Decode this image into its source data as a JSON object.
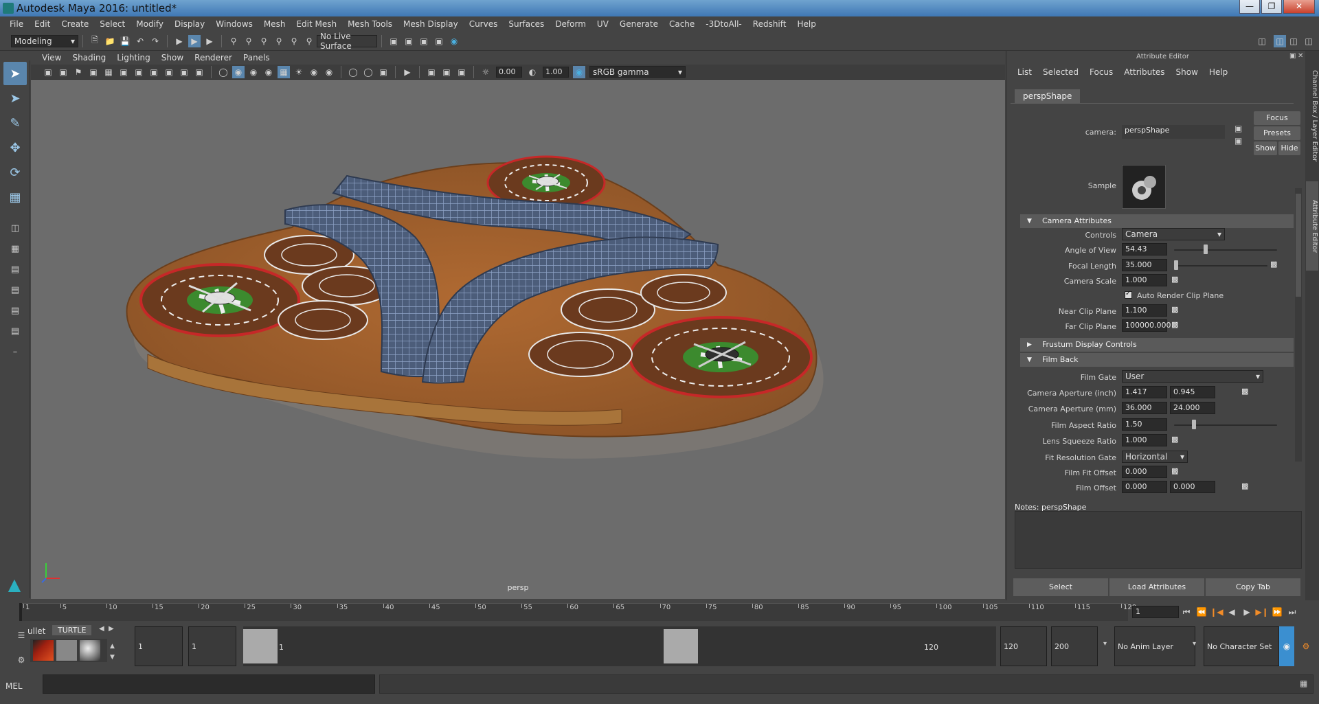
{
  "window": {
    "title": "Autodesk Maya 2016: untitled*"
  },
  "menubar": [
    "File",
    "Edit",
    "Create",
    "Select",
    "Modify",
    "Display",
    "Windows",
    "Mesh",
    "Edit Mesh",
    "Mesh Tools",
    "Mesh Display",
    "Curves",
    "Surfaces",
    "Deform",
    "UV",
    "Generate",
    "Cache",
    "-3DtoAll-",
    "Redshift",
    "Help"
  ],
  "shelf": {
    "menuset": "Modeling",
    "live_surface": "No Live Surface"
  },
  "viewport": {
    "menu": [
      "View",
      "Shading",
      "Lighting",
      "Show",
      "Renderer",
      "Panels"
    ],
    "exposure": "0.00",
    "gamma": "1.00",
    "color_space": "sRGB gamma",
    "camera_label": "persp"
  },
  "attribute_editor": {
    "title": "Attribute Editor",
    "menu": [
      "List",
      "Selected",
      "Focus",
      "Attributes",
      "Show",
      "Help"
    ],
    "tab": "perspShape",
    "camera_label": "camera:",
    "camera_value": "perspShape",
    "focus_btn": "Focus",
    "presets_btn": "Presets",
    "show_btn": "Show",
    "hide_btn": "Hide",
    "sample_label": "Sample",
    "sections": {
      "camera": "Camera Attributes",
      "frustum": "Frustum Display Controls",
      "filmback": "Film Back"
    },
    "controls": {
      "label": "Controls",
      "value": "Camera"
    },
    "angle_of_view": {
      "label": "Angle of View",
      "value": "54.43",
      "level": 0.3
    },
    "focal_length": {
      "label": "Focal Length",
      "value": "35.000",
      "level": 0.0
    },
    "camera_scale": {
      "label": "Camera Scale",
      "value": "1.000"
    },
    "auto_render_clip": {
      "label": "Auto Render Clip Plane",
      "checked": true
    },
    "near_clip": {
      "label": "Near Clip Plane",
      "value": "1.100"
    },
    "far_clip": {
      "label": "Far Clip Plane",
      "value": "100000.000"
    },
    "film_gate": {
      "label": "Film Gate",
      "value": "User"
    },
    "aperture_inch": {
      "label": "Camera Aperture (inch)",
      "v1": "1.417",
      "v2": "0.945"
    },
    "aperture_mm": {
      "label": "Camera Aperture (mm)",
      "v1": "36.000",
      "v2": "24.000"
    },
    "film_aspect": {
      "label": "Film Aspect Ratio",
      "value": "1.50",
      "level": 0.18
    },
    "lens_squeeze": {
      "label": "Lens Squeeze Ratio",
      "value": "1.000"
    },
    "fit_resolution": {
      "label": "Fit Resolution Gate",
      "value": "Horizontal"
    },
    "film_fit_offset": {
      "label": "Film Fit Offset",
      "value": "0.000"
    },
    "film_offset": {
      "label": "Film Offset",
      "v1": "0.000",
      "v2": "0.000"
    },
    "notes": "Notes:  perspShape",
    "buttons": {
      "select": "Select",
      "load": "Load Attributes",
      "copy": "Copy Tab"
    },
    "side_tabs": {
      "channel": "Channel Box / Layer Editor",
      "attr": "Attribute Editor"
    }
  },
  "timeline": {
    "ticks": [
      "1",
      "5",
      "10",
      "15",
      "20",
      "25",
      "30",
      "35",
      "40",
      "45",
      "50",
      "55",
      "60",
      "65",
      "70",
      "75",
      "80",
      "85",
      "90",
      "95",
      "100",
      "105",
      "110",
      "115",
      "120"
    ],
    "current": "1"
  },
  "range": {
    "shelf_tab_partial": "ullet",
    "shelf_tab": "TURTLE",
    "start": "1",
    "playback_start": "1",
    "range_min": "1",
    "range_max": "120",
    "playback_end": "120",
    "end": "200",
    "anim_layer": "No Anim Layer",
    "char_set": "No Character Set"
  },
  "command_line": {
    "label": "MEL"
  }
}
